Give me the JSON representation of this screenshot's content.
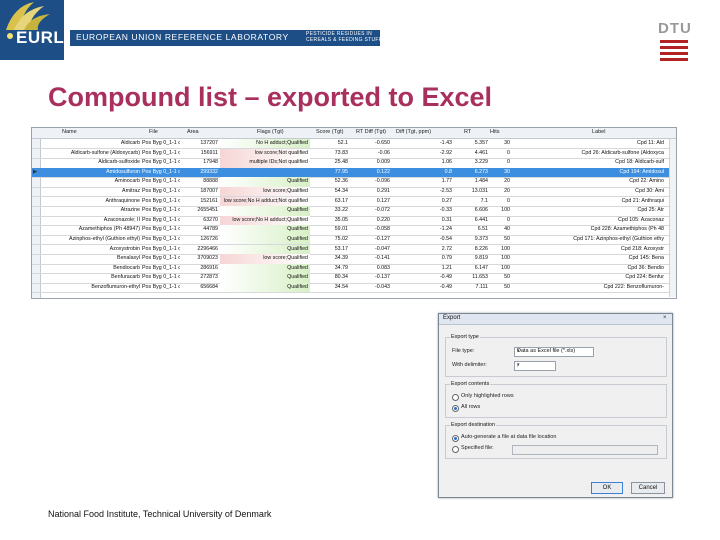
{
  "header": {
    "logo_text": "EURL",
    "banner_text": "EUROPEAN UNION REFERENCE LABORATORY",
    "banner_sub_line1": "PESTICIDE RESIDUES IN",
    "banner_sub_line2": "CEREALS & FEEDING STUFF",
    "dtu_text": "DTU"
  },
  "title": "Compound list – exported to Excel",
  "grid": {
    "columns": [
      "Name",
      "File",
      "Area",
      "Flags (Tgt)",
      "Score (Tgt)",
      "RT Diff (Tgt)",
      "Diff (Tgt, ppm)",
      "RT",
      "Hits",
      "Label"
    ],
    "rows": [
      [
        "Aldicarb",
        "Pos Byg 0_1-1 d",
        "137207",
        "No H adduct;Qualified",
        "52.1",
        "-0.650",
        "-1.43",
        "5.357",
        "30",
        "Cpd 11: Ald"
      ],
      [
        "Aldicarb-sulfone (Aldoxycarb)",
        "Pos Byg 0_1-1 d",
        "156911",
        "low score;Not qualified",
        "73.83",
        "-0.06",
        "-2.92",
        "4.461",
        "0",
        "Cpd 26: Aldicarb-sulfone (Aldoxyca"
      ],
      [
        "Aldicarb-sulfoxide",
        "Pos Byg 0_1-1 d",
        "17948",
        "multiple IDs;Not qualified",
        "25.48",
        "0.009",
        "1.06",
        "3.229",
        "0",
        "Cpd 18: Aldicarb-sulf"
      ],
      [
        "Amidosulfuron",
        "Pos Byg 0_1-1 d",
        "299332",
        "",
        "77.95",
        "0.122",
        "0.8",
        "6.273",
        "30",
        "Cpd 194: Amidosul"
      ],
      [
        "Aminocarb",
        "Pos Byg 0_1-1 d",
        "88888",
        "Qualified",
        "52.36",
        "-0.096",
        "1.77",
        "1.484",
        "20",
        "Cpd 22: Amino"
      ],
      [
        "Amitraz",
        "Pos Byg 0_1-1 d",
        "187007",
        "low score;Qualified",
        "54.34",
        "0.291",
        "-2.53",
        "13.031",
        "20",
        "Cpd 30: Ami"
      ],
      [
        "Anthraquinone",
        "Pos Byg 0_1-1 d",
        "152161",
        "low score;No H adduct;Not qualified",
        "63.17",
        "0.127",
        "0.27",
        "7.1",
        "0",
        "Cpd 21: Anthraqui"
      ],
      [
        "Atrazine",
        "Pos Byg 0_1-1 d",
        "2655451",
        "Qualified",
        "33.22",
        "-0.072",
        "-0.33",
        "6.606",
        "100",
        "Cpd 25: Atr"
      ],
      [
        "Azaconazole; II",
        "Pos Byg 0_1-1 d",
        "63270",
        "low score;No H adduct;Qualified",
        "35.05",
        "0.220",
        "0.31",
        "6.441",
        "0",
        "Cpd 105: Azaconaz"
      ],
      [
        "Azamethiphos (Ph 48947)",
        "Pos Byg 0_1-1 d",
        "44789",
        "Qualified",
        "59.01",
        "-0.058",
        "-1.24",
        "6.51",
        "40",
        "Cpd 228: Azamethiphos (Ph 48"
      ],
      [
        "Azinphos-ethyl (Guthion ethyl)",
        "Pos Byg 0_1-1 d",
        "126726",
        "Qualified",
        "75.02",
        "-0.127",
        "-0.54",
        "9.373",
        "50",
        "Cpd 171: Azinphos-ethyl (Guthion ethy"
      ],
      [
        "Azoxystrobin",
        "Pos Byg 0_1-1 d",
        "2296466",
        "Qualified",
        "53.17",
        "-0.047",
        "2.72",
        "8.226",
        "100",
        "Cpd 218: Azoxystr"
      ],
      [
        "Benalaxyl",
        "Pos Byg 0_1-1 d",
        "3709023",
        "low score;Qualified",
        "34.39",
        "-0.141",
        "0.79",
        "9.819",
        "100",
        "Cpd 145: Bena"
      ],
      [
        "Bendiocarb",
        "Pos Byg 0_1-1 d",
        "286916",
        "Qualified",
        "34.79",
        "0.083",
        "1.21",
        "6.147",
        "100",
        "Cpd 36: Bendio"
      ],
      [
        "Benfuracarb",
        "Pos Byg 0_1-1 d",
        "272873",
        "Qualified",
        "80.34",
        "-0.137",
        "-0.49",
        "11.653",
        "50",
        "Cpd 224: Benfur"
      ],
      [
        "Benzoflumuron-ethyl",
        "Pos Byg 0_1-1 d",
        "656684",
        "Qualified",
        "34.54",
        "-0.043",
        "-0.49",
        "7.111",
        "50",
        "Cpd 222: Benzoflumuron-"
      ]
    ]
  },
  "dialog": {
    "title": "Export",
    "close": "×",
    "export_type_label": "Export type",
    "file_type_label": "File type:",
    "file_type_value": "Data as Excel file (*.xls)",
    "with_delimiter_label": "With delimiter:",
    "delimiter_value": ",",
    "export_contents_label": "Export contents",
    "only_highlighted_label": "Only highlighted rows",
    "all_rows_label": "All rows",
    "export_destination_label": "Export destination",
    "auto_generate_label": "Auto-generate a file at data file location",
    "specified_file_label": "Specified file:",
    "ok_label": "OK",
    "cancel_label": "Cancel"
  },
  "footer": "National Food Institute, Technical University of Denmark",
  "colors": {
    "title": "#a9305e",
    "banner": "#1d4e86",
    "selected_row": "#3c8fe0",
    "flag_qualified": "#d7f0c6",
    "flag_warning": "#f6d6d6"
  }
}
